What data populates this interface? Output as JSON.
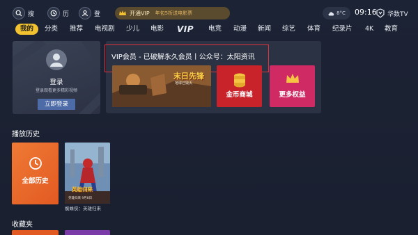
{
  "topbar": {
    "search_label": "搜",
    "history_label": "历",
    "login_label": "登",
    "vip_open": "开通VIP",
    "vip_ad": "年包5折送电影票",
    "temperature": "8°C",
    "time": "09:16",
    "brand": "华数TV"
  },
  "nav": {
    "items": [
      "我的",
      "分类",
      "推荐",
      "电视剧",
      "少儿",
      "电影",
      "VIP",
      "电竞",
      "动漫",
      "新闻",
      "综艺",
      "体育",
      "纪录片",
      "4K",
      "教育"
    ]
  },
  "login_card": {
    "title": "登录",
    "desc": "登录观看更多精彩视频",
    "button": "立即登录"
  },
  "vip_panel": {
    "headline": "VIP会员 - 已破解永久会员丨公众号：太阳资讯",
    "coin_mall": "金币商城",
    "more_rights": "更多权益",
    "poster_title": "末日先锋",
    "poster_subtitle": "地球已毁灭"
  },
  "history": {
    "title": "播放历史",
    "all_label": "全部历史",
    "movie_title": "蜘蛛侠：英雄归来",
    "movie_poster_text": "英雄归来",
    "movie_poster_sub": "英雄归来 9月8日"
  },
  "favorites": {
    "title": "收藏夹"
  },
  "colors": {
    "accent": "#f2c230",
    "highlight_box": "#e0333a",
    "coin_tile": "#c8222b",
    "rights_tile": "#cf2a63",
    "history_tile": "#e25a22"
  }
}
